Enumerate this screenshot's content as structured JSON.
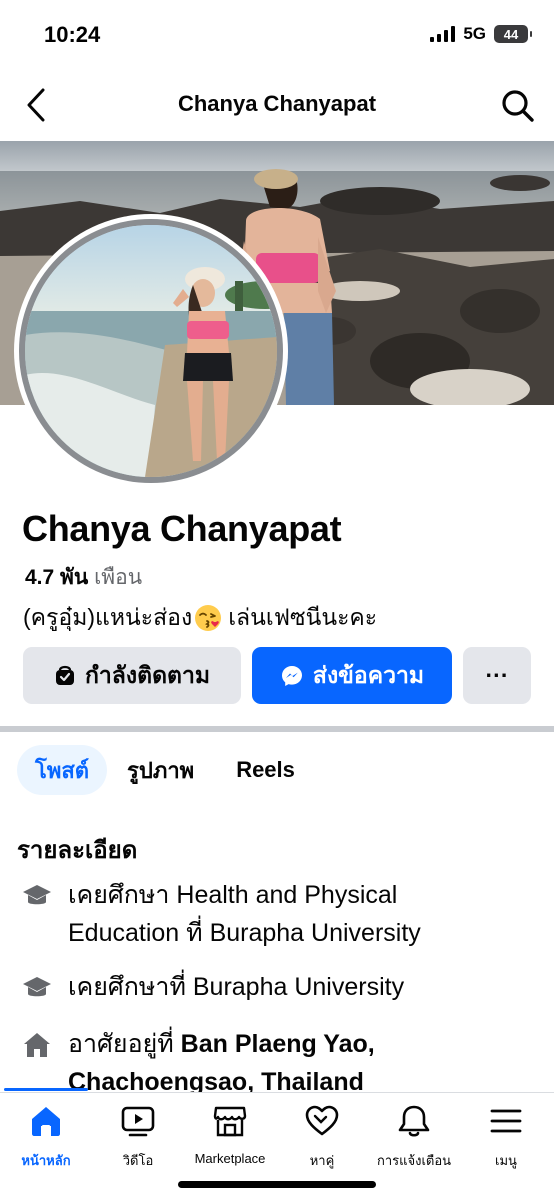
{
  "status_bar": {
    "time": "10:24",
    "network": "5G",
    "battery": "44"
  },
  "header": {
    "title": "Chanya Chanyapat",
    "back_icon": "chevron-left-icon",
    "search_icon": "search-icon"
  },
  "profile": {
    "name": "Chanya Chanyapat",
    "friends_count": "4.7 พัน",
    "friends_label": "เพือน",
    "bio_before_emoji": "(ครูอุ๋ม)แหน่ะส่อง",
    "bio_emoji": "kissing-face-emoji",
    "bio_after_emoji": "เล่นเฟซนีนะคะ"
  },
  "actions": {
    "following_label": "กำลังติดตาม",
    "message_label": "ส่งข้อความ",
    "more_label": "···"
  },
  "tabs": [
    {
      "label": "โพสต์",
      "active": true
    },
    {
      "label": "รูปภาพ",
      "active": false
    },
    {
      "label": "Reels",
      "active": false
    }
  ],
  "details": {
    "title": "รายละเอียด",
    "items": [
      {
        "icon": "graduation-cap-icon",
        "line1": "เคยศึกษา Health and Physical",
        "line2": "Education ที่ Burapha University"
      },
      {
        "icon": "graduation-cap-icon",
        "line1": "เคยศึกษาที่ Burapha University"
      },
      {
        "icon": "home-icon",
        "prefix": "อาศัยอยู่ที่ ",
        "bold1": "Ban Plaeng Yao,",
        "bold2": "Chachoengsao, Thailand"
      }
    ]
  },
  "bottom_nav": [
    {
      "label": "หน้าหลัก",
      "icon": "home-icon",
      "active": true
    },
    {
      "label": "วิดีโอ",
      "icon": "video-icon",
      "active": false
    },
    {
      "label": "Marketplace",
      "icon": "marketplace-icon",
      "active": false
    },
    {
      "label": "หาคู่",
      "icon": "dating-heart-icon",
      "active": false
    },
    {
      "label": "การแจ้งเตือน",
      "icon": "bell-icon",
      "active": false
    },
    {
      "label": "เมนู",
      "icon": "menu-icon",
      "active": false
    }
  ],
  "colors": {
    "accent": "#0866ff",
    "secondary_button": "#e4e6eb",
    "muted_text": "#65676b",
    "active_tab_bg": "#ebf5ff"
  }
}
